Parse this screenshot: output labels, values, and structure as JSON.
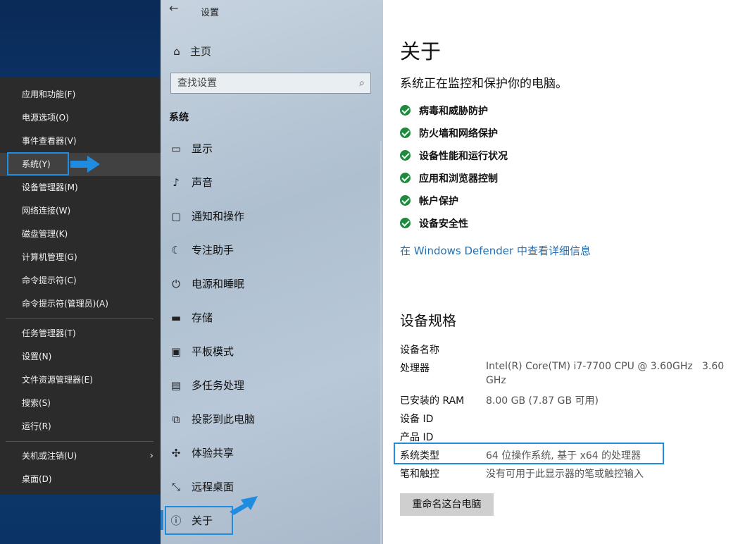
{
  "winx_menu": {
    "items": [
      {
        "label": "应用和功能(F)"
      },
      {
        "label": "电源选项(O)"
      },
      {
        "label": "事件查看器(V)"
      },
      {
        "label": "系统(Y)"
      },
      {
        "label": "设备管理器(M)"
      },
      {
        "label": "网络连接(W)"
      },
      {
        "label": "磁盘管理(K)"
      },
      {
        "label": "计算机管理(G)"
      },
      {
        "label": "命令提示符(C)"
      },
      {
        "label": "命令提示符(管理员)(A)"
      },
      {
        "label": "任务管理器(T)"
      },
      {
        "label": "设置(N)"
      },
      {
        "label": "文件资源管理器(E)"
      },
      {
        "label": "搜索(S)"
      },
      {
        "label": "运行(R)"
      },
      {
        "label": "关机或注销(U)"
      },
      {
        "label": "桌面(D)"
      }
    ]
  },
  "settings_nav": {
    "back_icon": "←",
    "title": "设置",
    "home_label": "主页",
    "search_placeholder": "查找设置",
    "section": "系统",
    "items": [
      {
        "label": "显示",
        "icon": "display-icon"
      },
      {
        "label": "声音",
        "icon": "sound-icon"
      },
      {
        "label": "通知和操作",
        "icon": "notification-icon"
      },
      {
        "label": "专注助手",
        "icon": "moon-icon"
      },
      {
        "label": "电源和睡眠",
        "icon": "power-icon"
      },
      {
        "label": "存储",
        "icon": "storage-icon"
      },
      {
        "label": "平板模式",
        "icon": "tablet-icon"
      },
      {
        "label": "多任务处理",
        "icon": "multitask-icon"
      },
      {
        "label": "投影到此电脑",
        "icon": "project-icon"
      },
      {
        "label": "体验共享",
        "icon": "share-icon"
      },
      {
        "label": "远程桌面",
        "icon": "remote-icon"
      },
      {
        "label": "关于",
        "icon": "info-icon"
      }
    ]
  },
  "content": {
    "title": "关于",
    "lead": "系统正在监控和保护你的电脑。",
    "protections": [
      {
        "label": "病毒和威胁防护"
      },
      {
        "label": "防火墙和网络保护"
      },
      {
        "label": "设备性能和运行状况"
      },
      {
        "label": "应用和浏览器控制"
      },
      {
        "label": "帐户保护"
      },
      {
        "label": "设备安全性"
      }
    ],
    "defender_link": "在 Windows Defender 中查看详细信息",
    "spec_heading": "设备规格",
    "specs": [
      {
        "label": "设备名称",
        "value": ""
      },
      {
        "label": "处理器",
        "value": "Intel(R) Core(TM) i7-7700 CPU @ 3.60GHz   3.60",
        "value2": "GHz"
      },
      {
        "label": "已安装的 RAM",
        "value": "8.00 GB (7.87 GB 可用)"
      },
      {
        "label": "设备 ID",
        "value": ""
      },
      {
        "label": "产品 ID",
        "value": ""
      },
      {
        "label": "系统类型",
        "value": "64 位操作系统, 基于 x64 的处理器"
      },
      {
        "label": "笔和触控",
        "value": "没有可用于此显示器的笔或触控输入"
      }
    ],
    "rename_button": "重命名这台电脑"
  },
  "colors": {
    "accent": "#1f8ce0",
    "check": "#1d8a3e",
    "link": "#2470b3"
  }
}
